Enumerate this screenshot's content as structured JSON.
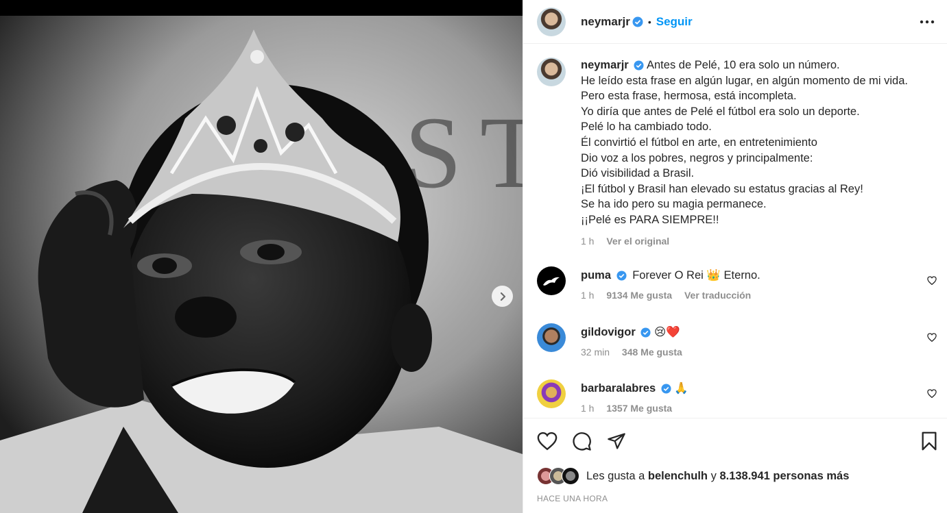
{
  "post": {
    "author": "neymarjr",
    "follow_label": "Seguir",
    "separator": "•"
  },
  "caption": {
    "author": "neymarjr",
    "lines": [
      "Antes de Pelé, 10 era solo un número.",
      "He leído esta frase en algún lugar, en algún momento de mi vida.",
      "Pero esta frase, hermosa, está incompleta.",
      "Yo diría que antes de Pelé el fútbol era solo un deporte.",
      "Pelé lo ha cambiado todo.",
      "Él convirtió el fútbol en arte, en entretenimiento",
      "Dio voz a los pobres, negros y principalmente:",
      "Dió visibilidad a Brasil.",
      "¡El fútbol y Brasil han elevado su estatus gracias al Rey!",
      "Se ha ido pero su magia permanece.",
      "¡¡Pelé es PARA SIEMPRE!!"
    ],
    "time": "1 h",
    "see_original": "Ver el original"
  },
  "comments": [
    {
      "user": "puma",
      "text": "Forever O Rei",
      "emoji": "👑",
      "text_after": "Eterno.",
      "time": "1 h",
      "likes": "9134 Me gusta",
      "translate": "Ver traducción"
    },
    {
      "user": "gildovigor",
      "text": "",
      "emoji": "😢❤️",
      "text_after": "",
      "time": "32 min",
      "likes": "348 Me gusta",
      "translate": ""
    },
    {
      "user": "barbaralabres",
      "text": "",
      "emoji": "🙏",
      "text_after": "",
      "time": "1 h",
      "likes": "1357 Me gusta",
      "translate": ""
    }
  ],
  "likes": {
    "prefix": "Les gusta a",
    "user": "belenchulh",
    "connector": "y",
    "count": "8.138.941 personas más"
  },
  "timestamp": "HACE UNA HORA",
  "colors": {
    "accent": "#0095f6",
    "verified": "#3897f0",
    "text": "#262626",
    "muted": "#8e8e8e",
    "border": "#efefef"
  },
  "icons": {
    "like": "heart-icon",
    "comment": "comment-icon",
    "share": "send-icon",
    "save": "bookmark-icon",
    "more": "more-icon",
    "next": "chevron-right-icon"
  }
}
